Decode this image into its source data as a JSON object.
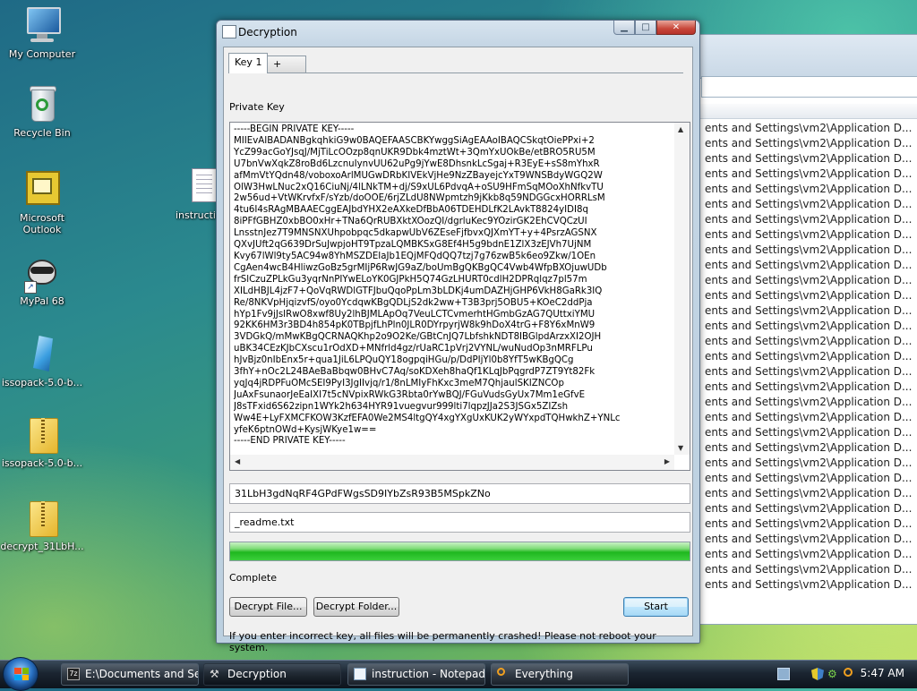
{
  "desktop": {
    "icons": [
      {
        "label": "My Computer"
      },
      {
        "label": "Recycle Bin"
      },
      {
        "label": "Microsoft Outlook"
      },
      {
        "label": "instruction"
      },
      {
        "label": "MyPal 68"
      },
      {
        "label": "issopack-5.0-b..."
      },
      {
        "label": "issopack-5.0-b..."
      },
      {
        "label": "decrypt_31LbH..."
      }
    ]
  },
  "background_window": {
    "row_text": "ents and Settings\\vm2\\Application D...",
    "row_count": 31
  },
  "dialog": {
    "title": "Decryption",
    "tabs": [
      {
        "label": "Key 1"
      },
      {
        "label": "+"
      }
    ],
    "private_key_label": "Private Key",
    "private_key_lines": [
      "-----BEGIN PRIVATE KEY-----",
      "MIIEvAIBADANBgkqhkiG9w0BAQEFAASCBKYwggSiAgEAAoIBAQCSkqtOiePPxi+2",
      "YcZ99acGoYJsqJ/MjTiLcOOzp8qnUKR9Dbk4mztWt+3QmYxUOkBe/etBRO5RU5M",
      "U7bnVwXqkZ8roBd6LzcnuIynvUU62uPg9jYwE8DhsnkLcSgaj+R3EyE+sS8mYhxR",
      "afMmVtYQdn48/voboxoArlMUGwDRbKIVEkVjHe9NzZBayejcYxT9WNSBdyWGQ2W",
      "OlW3HwLNuc2xQ16CiuNj/4lLNkTM+dj/S9xUL6PdvqA+oSU9HFmSqMOoXhNfkvTU",
      "2w56ud+VtWKrvfxF/sYzb/doOOE/6rjZLdU8NWpmtzh9jKkb8q59NDGGcxHORRLsM",
      "4tu6I4sRAgMBAAECggEAJbdYHX2eAXkeDfBbA06TDEHDLfK2LAvkT8824yIDI8q",
      "8iPFfGBHZ0xbBO0xHr+TNa6QrRUBXktXOozQI/dgrluKec9YOzirGK2EhCVQCzUI",
      "LnsstnJez7T9MNSNXUhpobpqc5dkapwUbV6ZEseFjfbvxQJXmYT+y+4PsrzAGSNX",
      "QXvJUft2qG639DrSuJwpjoHT9TpzaLQMBKSxG8Ef4H5g9bdnE1ZlX3zEJVh7UjNM",
      "Kvy67lWl9ty5AC94w8YhMSZDEIaJb1EQjMFQdQQ7tzj7g76zwB5k6eo9Zkw/1OEn",
      "CgAen4wcB4HliwzGoBz5grMIjP6RwJG9aZ/boUmBgQKBgQC4Vwb4WfpBXOjuwUDb",
      "frSlCzuZPLkGu3yqrNnPIYwELoYK0GJPkH5Q74GzLHURT0cdlH2DPRqlqz7pl57m",
      "XILdHBJL4jzF7+QoVqRWDlGTFJbuQqoPpLm3bLDKj4umDAZHjGHP6VkH8GaRk3IQ",
      "Re/8NKVpHjqizvfS/oyo0YcdqwKBgQDLjS2dk2ww+T3B3prj5OBU5+KOeC2ddPja",
      "hYp1Fv9jJsIRwO8xwf8Uy2lhBJMLApOq7VeuLCTCvmerhtHGmbGzAG7QUttxiYMU",
      "92KK6HM3r3BD4h854pK0TBpjfLhPln0JLR0DYrpyrjW8k9hDoX4trG+F8Y6xMnW9",
      "3VDGkQ/mMwKBgQCRNAQKhp2o9O2Ke/GBtCnJQ7LbfshkNDT8IBGlpdArzxXI2OJH",
      "uBK34CEzKJbCXscu1rOdXD+MNfrld4gz/rUaRC1pVrj2VYNL/wuNudOp3nMRFLPu",
      "hJvBjz0nIbEnx5r+qua1JiL6LPQuQY18ogpqiHGu/p/DdPIjYl0b8YfT5wKBgQCg",
      "3fhY+nOc2L24BAeBaBbqw0BHvC7Aq/soKDXeh8haQf1KLqJbPqgrdP7ZT9Yt82Fk",
      "yqJq4jRDPFuOMcSEI9PyI3JgIIvjq/r1/8nLMIyFhKxc3meM7QhjaulSKIZNCOp",
      "JuAxFsunaorJeEaIXI7t5cNVpixRWkG3Rbta0rYwBQJ/FGuVudsGyUx7Mm1eGfvE",
      "J8sTFxid6S62zipn1WYk2h634HYR91vuegvur999lti7lqpzJJa2S3JSGx5ZIZsh",
      "Ww4E+LyFXMCFKOW3KzfEFA0We2MS4ltgQY4xgYXgUxKUK2yWYxpdTQHwkhZ+YNLc",
      "yfeK6ptnOWd+KysjWKye1w==",
      "-----END PRIVATE KEY-----"
    ],
    "key_id_value": "31LbH3gdNqRF4GPdFWgsSD9IYbZsR93B5MSpkZNo",
    "readme_value": "_readme.txt",
    "progress_fraction": 1.0,
    "status_text": "Complete",
    "decrypt_file_label": "Decrypt File...",
    "decrypt_folder_label": "Decrypt Folder...",
    "start_label": "Start",
    "warning_text": "If you enter incorrect key, all files will be permanently crashed! Please not reboot your system."
  },
  "taskbar": {
    "buttons": [
      {
        "label": "E:\\Documents and Se..."
      },
      {
        "label": "Decryption"
      },
      {
        "label": "instruction - Notepad"
      },
      {
        "label": "Everything"
      }
    ],
    "clock": "5:47 AM"
  },
  "colors": {
    "progress_fill": "#1fb81f",
    "dialog_frame": "#bcd0e0",
    "taskbar": "#1b2531"
  }
}
